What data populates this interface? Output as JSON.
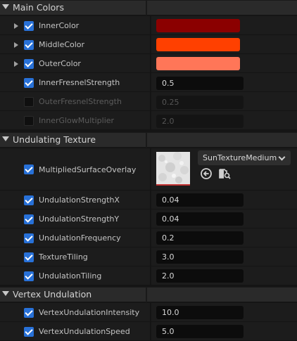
{
  "sections": {
    "main_colors": "Main Colors",
    "undulating_texture": "Undulating Texture",
    "vertex_undulation": "Vertex Undulation"
  },
  "main_colors": {
    "inner_color": {
      "label": "InnerColor",
      "color": "#8b0000"
    },
    "middle_color": {
      "label": "MiddleColor",
      "color": "#ff4000"
    },
    "outer_color": {
      "label": "OuterColor",
      "color": "#ff7658"
    },
    "inner_fresnel": {
      "label": "InnerFresnelStrength",
      "value": "0.5"
    },
    "outer_fresnel": {
      "label": "OuterFresnelStrength",
      "value": "0.25"
    },
    "inner_glow": {
      "label": "InnerGlowMultiplier",
      "value": "2.0"
    }
  },
  "undulating_texture": {
    "surface_overlay": {
      "label": "MultipliedSurfaceOverlay",
      "texture": "SunTextureMedium"
    },
    "strength_x": {
      "label": "UndulationStrengthX",
      "value": "0.04"
    },
    "strength_y": {
      "label": "UndulationStrengthY",
      "value": "0.04"
    },
    "frequency": {
      "label": "UndulationFrequency",
      "value": "0.2"
    },
    "texture_tiling": {
      "label": "TextureTiling",
      "value": "3.0"
    },
    "undulation_tiling": {
      "label": "UndulationTiling",
      "value": "2.0"
    }
  },
  "vertex_undulation": {
    "intensity": {
      "label": "VertexUndulationIntensity",
      "value": "10.0"
    },
    "speed": {
      "label": "VertexUndulationSpeed",
      "value": "5.0"
    }
  },
  "colors": {
    "accent": "#2871d8"
  },
  "icons": [
    "section-collapse-icon",
    "row-expand-icon",
    "checkbox-icon",
    "use-selected-icon",
    "browse-asset-icon",
    "dropdown-chevron-icon"
  ]
}
